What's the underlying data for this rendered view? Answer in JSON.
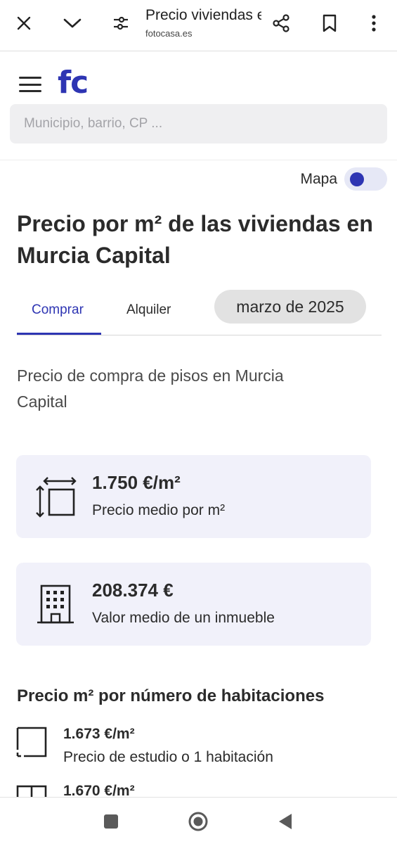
{
  "browser": {
    "title": "Precio viviendas en Murcia Capital",
    "domain": "fotocasa.es",
    "icons": [
      "close-icon",
      "chevron-down-icon",
      "tune-icon",
      "share-icon",
      "bookmark-icon",
      "more-vert-icon"
    ]
  },
  "header": {
    "logo": "fc",
    "search_placeholder": "Municipio, barrio, CP ..."
  },
  "map_toggle": {
    "label": "Mapa",
    "on": false
  },
  "page_title": "Precio por m² de las viviendas en Murcia Capital",
  "tabs": [
    {
      "label": "Comprar",
      "active": true
    },
    {
      "label": "Alquiler",
      "active": false
    }
  ],
  "date_selector": "marzo de 2025",
  "subtitle": "Precio de compra de pisos en Murcia Capital",
  "cards": [
    {
      "value": "1.750 €/m²",
      "label": "Precio medio por m²",
      "icon": "area-size-icon"
    },
    {
      "value": "208.374 €",
      "label": "Valor medio de un inmueble",
      "icon": "building-icon"
    }
  ],
  "rooms_section": {
    "title": "Precio m² por número de habitaciones",
    "rows": [
      {
        "value": "1.673 €/m²",
        "label": "Precio de estudio o 1 habitación",
        "icon": "room-icon"
      },
      {
        "value": "1.670 €/m²",
        "label": "",
        "icon": "room-icon"
      }
    ]
  },
  "colors": {
    "brand": "#2e35b3",
    "card_bg": "#f1f1fa"
  }
}
